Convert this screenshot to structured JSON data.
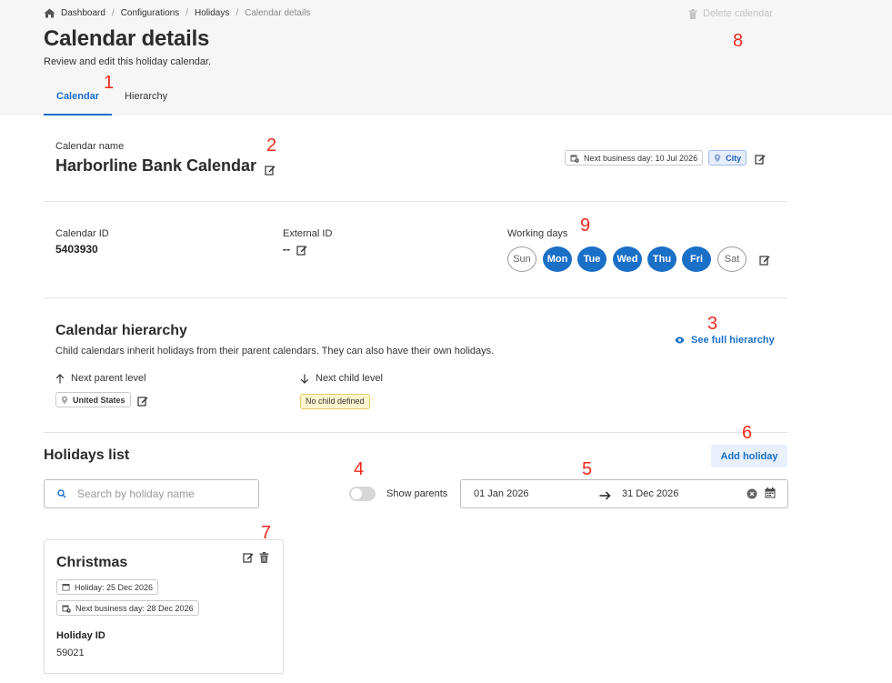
{
  "breadcrumb": {
    "icon": "home-icon",
    "items": [
      "Dashboard",
      "Configurations",
      "Holidays"
    ],
    "current": "Calendar details"
  },
  "header": {
    "title": "Calendar details",
    "subtitle": "Review and edit this holiday calendar.",
    "delete_label": "Delete calendar"
  },
  "tabs": [
    {
      "label": "Calendar",
      "active": true
    },
    {
      "label": "Hierarchy",
      "active": false
    }
  ],
  "annotations": [
    "1",
    "2",
    "3",
    "4",
    "5",
    "6",
    "7",
    "8",
    "9"
  ],
  "calendar": {
    "name_label": "Calendar name",
    "name": "Harborline Bank Calendar",
    "next_business_day": "Next business day: 10 Jul 2026",
    "type_badge": "City",
    "id_label": "Calendar ID",
    "id_value": "5403930",
    "external_id_label": "External ID",
    "external_id_value": "--",
    "working_days_label": "Working days",
    "working_days": [
      {
        "label": "Sun",
        "active": false
      },
      {
        "label": "Mon",
        "active": true
      },
      {
        "label": "Tue",
        "active": true
      },
      {
        "label": "Wed",
        "active": true
      },
      {
        "label": "Thu",
        "active": true
      },
      {
        "label": "Fri",
        "active": true
      },
      {
        "label": "Sat",
        "active": false
      }
    ]
  },
  "hierarchy": {
    "title": "Calendar hierarchy",
    "description": "Child calendars inherit holidays from their parent calendars. They can also have their own holidays.",
    "see_full_label": "See full hierarchy",
    "parent_label": "Next parent level",
    "parent_value": "United States",
    "child_label": "Next child level",
    "child_value": "No child defined"
  },
  "holidays": {
    "title": "Holidays list",
    "add_label": "Add holiday",
    "search_placeholder": "Search by holiday name",
    "show_parents_label": "Show parents",
    "show_parents_on": false,
    "date_from": "01 Jan 2026",
    "date_to": "31 Dec 2026",
    "items": [
      {
        "name": "Christmas",
        "holiday_date": "Holiday: 25 Dec 2026",
        "next_business_day": "Next business day: 28 Dec 2026",
        "id_label": "Holiday ID",
        "id_value": "59021"
      }
    ]
  },
  "colors": {
    "accent": "#1a6fc7",
    "annotation": "#ee2a1e",
    "header_bg": "#f6f6f6",
    "city_badge_bg": "#e7eefb",
    "no_child_bg": "#fff6cf"
  }
}
